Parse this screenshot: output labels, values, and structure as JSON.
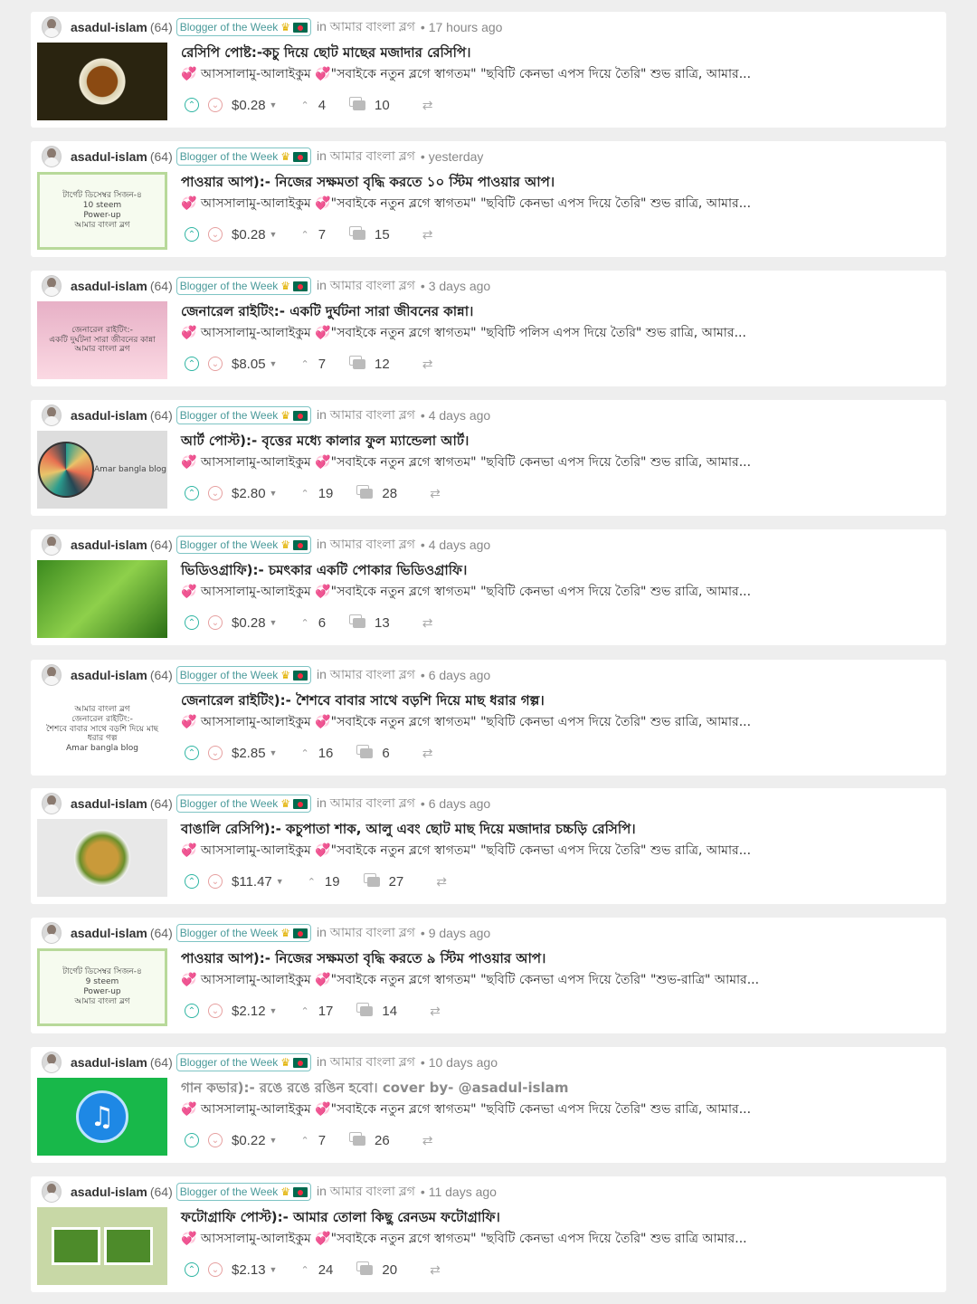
{
  "posts": [
    {
      "author": "asadul-islam",
      "rep": "(64)",
      "badge": "Blogger of the Week",
      "community": "in আমার বাংলা ব্লগ",
      "time": "• 17 hours ago",
      "title": "রেসিপি পোষ্ট:-কচু দিয়ে ছোট মাছের মজাদার রেসিপি।",
      "excerpt": "💞 আসসালামু-আলাইকুম 💞\"সবাইকে নতুন ব্লগে স্বাগতম\" \"ছবিটি কেনভা এপস দিয়ে তৈরি\" শুভ রাত্রি, আমার...",
      "payout": "$0.28",
      "votes": "4",
      "comments": "10",
      "thumb": "recipe"
    },
    {
      "author": "asadul-islam",
      "rep": "(64)",
      "badge": "Blogger of the Week",
      "community": "in আমার বাংলা ব্লগ",
      "time": "• yesterday",
      "title": "পাওয়ার আপ):- নিজের সক্ষমতা বৃদ্ধি করতে ১০ স্টিম পাওয়ার আপ।",
      "excerpt": "💞 আসসালামু-আলাইকুম 💞\"সবাইকে নতুন ব্লগে স্বাগতম\" \"ছবিটি কেনভা এপস দিয়ে তৈরি\" শুভ রাত্রি, আমার...",
      "payout": "$0.28",
      "votes": "7",
      "comments": "15",
      "thumb": "power",
      "thumb_text": [
        "টার্গেট ডিসেম্বর সিজন-৪",
        "10 steem",
        "Power-up",
        "আমার বাংলা ব্লগ"
      ]
    },
    {
      "author": "asadul-islam",
      "rep": "(64)",
      "badge": "Blogger of the Week",
      "community": "in আমার বাংলা ব্লগ",
      "time": "• 3 days ago",
      "title": "জেনারেল রাইটিং:- একটি দুর্ঘটনা সারা জীবনের কান্না।",
      "excerpt": "💞 আসসালামু-আলাইকুম 💞\"সবাইকে নতুন ব্লগে স্বাগতম\" \"ছবিটি পলিস এপস দিয়ে তৈরি\" শুভ রাত্রি, আমার...",
      "payout": "$8.05",
      "votes": "7",
      "comments": "12",
      "thumb": "general",
      "thumb_text": [
        "জেনারেল রাইটিং:-",
        "একটি দুর্ঘটনা সারা জীবনের কান্না",
        "আমার বাংলা ব্লগ"
      ]
    },
    {
      "author": "asadul-islam",
      "rep": "(64)",
      "badge": "Blogger of the Week",
      "community": "in আমার বাংলা ব্লগ",
      "time": "• 4 days ago",
      "title": "আর্ট পোস্ট):- বৃত্তের মধ্যে কালার ফুল ম্যান্ডেলা আর্ট।",
      "excerpt": "💞 আসসালামু-আলাইকুম 💞\"সবাইকে নতুন ব্লগে স্বাগতম\" \"ছবিটি কেনভা এপস দিয়ে তৈরি\" শুভ রাত্রি, আমার...",
      "payout": "$2.80",
      "votes": "19",
      "comments": "28",
      "thumb": "art",
      "thumb_text": [
        "Amar bangla blog"
      ]
    },
    {
      "author": "asadul-islam",
      "rep": "(64)",
      "badge": "Blogger of the Week",
      "community": "in আমার বাংলা ব্লগ",
      "time": "• 4 days ago",
      "title": "ভিডিওগ্রাফি):- চমৎকার একটি পোকার ভিডিওগ্রাফি।",
      "excerpt": "💞 আসসালামু-আলাইকুম 💞\"সবাইকে নতুন ব্লগে স্বাগতম\" \"ছবিটি কেনভা এপস দিয়ে তৈরি\" শুভ রাত্রি, আমার...",
      "payout": "$0.28",
      "votes": "6",
      "comments": "13",
      "thumb": "video"
    },
    {
      "author": "asadul-islam",
      "rep": "(64)",
      "badge": "Blogger of the Week",
      "community": "in আমার বাংলা ব্লগ",
      "time": "• 6 days ago",
      "title": "জেনারেল রাইটিং):- শৈশবে বাবার সাথে বড়শি দিয়ে মাছ ধরার গল্প।",
      "excerpt": "💞 আসসালামু-আলাইকুম 💞\"সবাইকে নতুন ব্লগে স্বাগতম\" \"ছবিটি কেনভা এপস দিয়ে তৈরি\" শুভ রাত্রি, আমার...",
      "payout": "$2.85",
      "votes": "16",
      "comments": "6",
      "thumb": "write",
      "thumb_text": [
        "আমার বাংলা ব্লগ",
        "জেনারেল রাইটিং:-",
        "শৈশবে বাবার সাথে বড়শি দিয়ে মাছ ধরার গল্প",
        "Amar bangla blog"
      ]
    },
    {
      "author": "asadul-islam",
      "rep": "(64)",
      "badge": "Blogger of the Week",
      "community": "in আমার বাংলা ব্লগ",
      "time": "• 6 days ago",
      "title": "বাঙালি রেসিপি):- কচুপাতা শাক, আলু এবং ছোট মাছ দিয়ে মজাদার চচ্চড়ি রেসিপি।",
      "excerpt": "💞 আসসালামু-আলাইকুম 💞\"সবাইকে নতুন ব্লগে স্বাগতম\" \"ছবিটি কেনভা এপস দিয়ে তৈরি\" শুভ রাত্রি, আমার...",
      "payout": "$11.47",
      "votes": "19",
      "comments": "27",
      "thumb": "food2"
    },
    {
      "author": "asadul-islam",
      "rep": "(64)",
      "badge": "Blogger of the Week",
      "community": "in আমার বাংলা ব্লগ",
      "time": "• 9 days ago",
      "title": "পাওয়ার আপ):- নিজের সক্ষমতা বৃদ্ধি করতে ৯ স্টিম পাওয়ার আপ।",
      "excerpt": "💞 আসসালামু-আলাইকুম 💞\"সবাইকে নতুন ব্লগে স্বাগতম\" \"ছবিটি কেনভা এপস দিয়ে তৈরি\" \"শুভ-রাত্রি\" আমার...",
      "payout": "$2.12",
      "votes": "17",
      "comments": "14",
      "thumb": "power",
      "thumb_text": [
        "টার্গেট ডিসেম্বর সিজন-৪",
        "9 steem",
        "Power-up",
        "আমার বাংলা ব্লগ"
      ]
    },
    {
      "author": "asadul-islam",
      "rep": "(64)",
      "badge": "Blogger of the Week",
      "community": "in আমার বাংলা ব্লগ",
      "time": "• 10 days ago",
      "title": "গান কভার):- রঙে রঙে রঙিন হবো। cover by- @asadul-islam",
      "excerpt": "💞 আসসালামু-আলাইকুম 💞\"সবাইকে নতুন ব্লগে স্বাগতম\" \"ছবিটি কেনভা এপস দিয়ে তৈরি\" শুভ রাত্রি, আমার...",
      "payout": "$0.22",
      "votes": "7",
      "comments": "26",
      "thumb": "music",
      "title_gray": true
    },
    {
      "author": "asadul-islam",
      "rep": "(64)",
      "badge": "Blogger of the Week",
      "community": "in আমার বাংলা ব্লগ",
      "time": "• 11 days ago",
      "title": "ফটোগ্রাফি পোস্ট):- আমার তোলা কিছু রেনডম ফটোগ্রাফি।",
      "excerpt": "💞 আসসালামু-আলাইকুম 💞\"সবাইকে নতুন ব্লগে স্বাগতম\" \"ছবিটি কেনভা এপস দিয়ে তৈরি\" শুভ রাত্রি আমার...",
      "payout": "$2.13",
      "votes": "24",
      "comments": "20",
      "thumb": "photo"
    }
  ],
  "icons": {
    "upvote": "chevron-up-icon",
    "downvote": "chevron-down-icon",
    "votes": "caret-up-icon",
    "comments": "comments-icon",
    "resteem": "resteem-icon"
  },
  "colors": {
    "upvote": "#2fb5a3",
    "downvote": "#e6a0a0",
    "badge": "#4a9a9a",
    "background": "#eeeeee"
  }
}
